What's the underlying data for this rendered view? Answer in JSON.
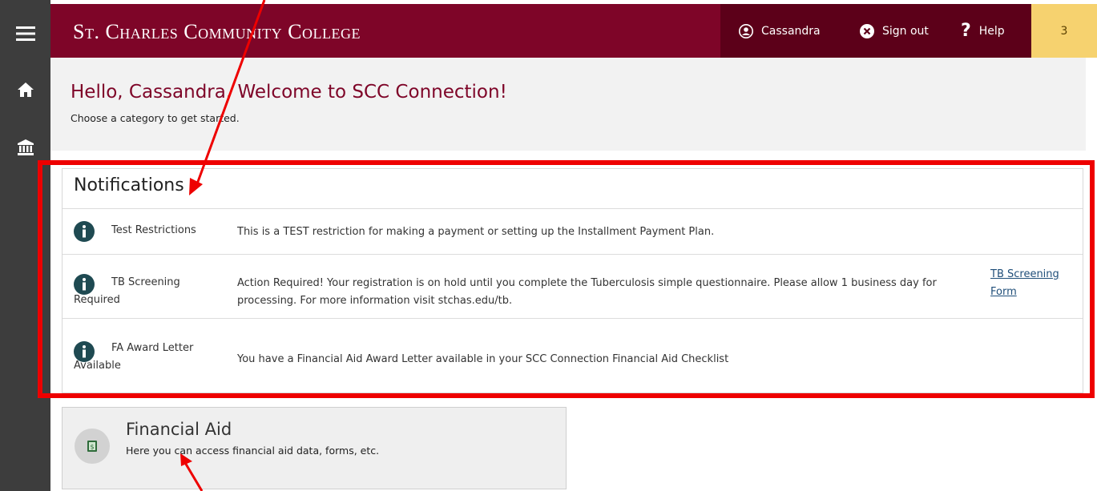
{
  "header": {
    "brand_name": "St. Charles Community College",
    "user_label": "Cassandra",
    "signout_label": "Sign out",
    "help_label": "Help",
    "badge_count": "3"
  },
  "sidebar": {
    "icons": [
      "menu-icon",
      "home-icon",
      "bank-icon"
    ]
  },
  "welcome": {
    "heading": "Hello, Cassandra. Welcome to SCC Connection!",
    "subheading": "Choose a category to get started."
  },
  "notifications": {
    "title": "Notifications",
    "items": [
      {
        "title_line1": "Test Restrictions",
        "title_line2": "",
        "message": "This is a TEST restriction for making a payment or setting up the Installment Payment Plan.",
        "link": ""
      },
      {
        "title_line1": "TB Screening",
        "title_line2": "Required",
        "message": "Action Required! Your registration is on hold until you complete the Tuberculosis simple questionnaire. Please allow 1 business day for processing. For more information visit stchas.edu/tb.",
        "link": "TB Screening Form"
      },
      {
        "title_line1": "FA Award Letter",
        "title_line2": "Available",
        "message": "You have a Financial Aid Award Letter available in your SCC Connection Financial Aid Checklist",
        "link": ""
      }
    ]
  },
  "categories": [
    {
      "title": "Financial Aid",
      "description": "Here you can access financial aid data, forms, etc."
    }
  ],
  "colors": {
    "brand": "#7e0528",
    "brand_dark": "#5c0019",
    "badge": "#f6d26f",
    "info_icon": "#1f4a52",
    "highlight": "#ee0000",
    "sidebar": "#3d3d3d"
  }
}
